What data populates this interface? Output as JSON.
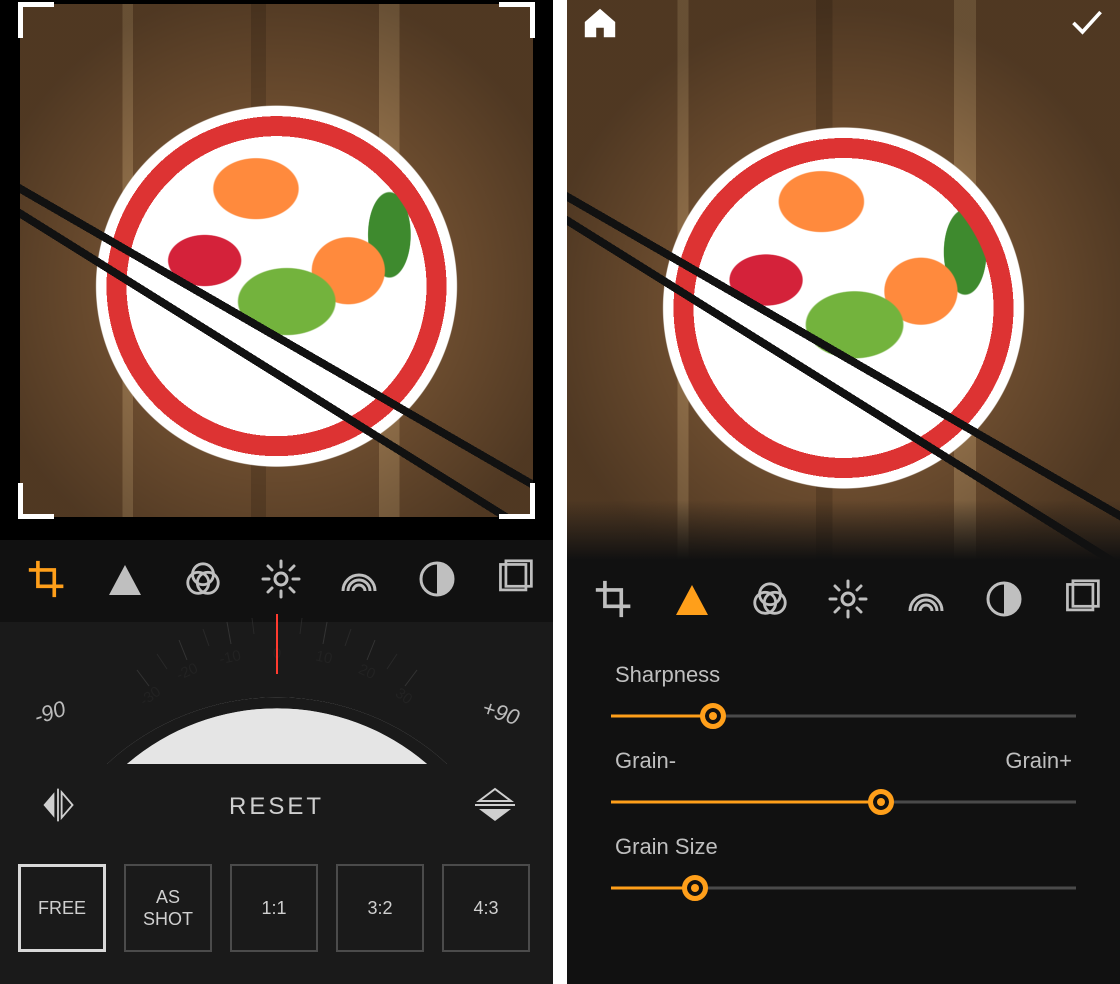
{
  "accent": "#ff9f1a",
  "left": {
    "active_tool": "crop",
    "tools": [
      {
        "id": "crop",
        "icon": "crop-icon"
      },
      {
        "id": "sharpen",
        "icon": "triangle-icon"
      },
      {
        "id": "filters",
        "icon": "overlap-circles-icon"
      },
      {
        "id": "light",
        "icon": "brightness-icon"
      },
      {
        "id": "color",
        "icon": "rainbow-icon"
      },
      {
        "id": "bw",
        "icon": "half-circle-ab-icon"
      },
      {
        "id": "frames",
        "icon": "frames-icon"
      }
    ],
    "rotation": {
      "minus90_label": "-90",
      "plus90_label": "+90",
      "dial_ticks": [
        "-30",
        "-20",
        "-10",
        "0",
        "10",
        "20",
        "30"
      ],
      "current_deg": 0
    },
    "reset_label": "RESET",
    "flip": {
      "horizontal_icon": "flip-horizontal-icon",
      "vertical_icon": "flip-vertical-icon"
    },
    "ratios": [
      {
        "label": "FREE",
        "selected": true
      },
      {
        "label": "AS\nSHOT",
        "selected": false
      },
      {
        "label": "1:1",
        "selected": false
      },
      {
        "label": "3:2",
        "selected": false
      },
      {
        "label": "4:3",
        "selected": false
      }
    ]
  },
  "right": {
    "active_tool": "sharpen",
    "topbar": {
      "home_icon": "home-icon",
      "confirm_icon": "check-icon"
    },
    "tools": [
      {
        "id": "crop",
        "icon": "crop-icon"
      },
      {
        "id": "sharpen",
        "icon": "triangle-icon"
      },
      {
        "id": "filters",
        "icon": "overlap-circles-icon"
      },
      {
        "id": "light",
        "icon": "brightness-icon"
      },
      {
        "id": "color",
        "icon": "rainbow-icon"
      },
      {
        "id": "bw",
        "icon": "half-circle-ab-icon"
      },
      {
        "id": "frames",
        "icon": "frames-icon"
      }
    ],
    "sliders": {
      "sharpness": {
        "label": "Sharpness",
        "value_pct": 22
      },
      "grain": {
        "label_left": "Grain-",
        "label_right": "Grain+",
        "value_pct": 58
      },
      "grain_size": {
        "label": "Grain Size",
        "value_pct": 18
      }
    }
  }
}
